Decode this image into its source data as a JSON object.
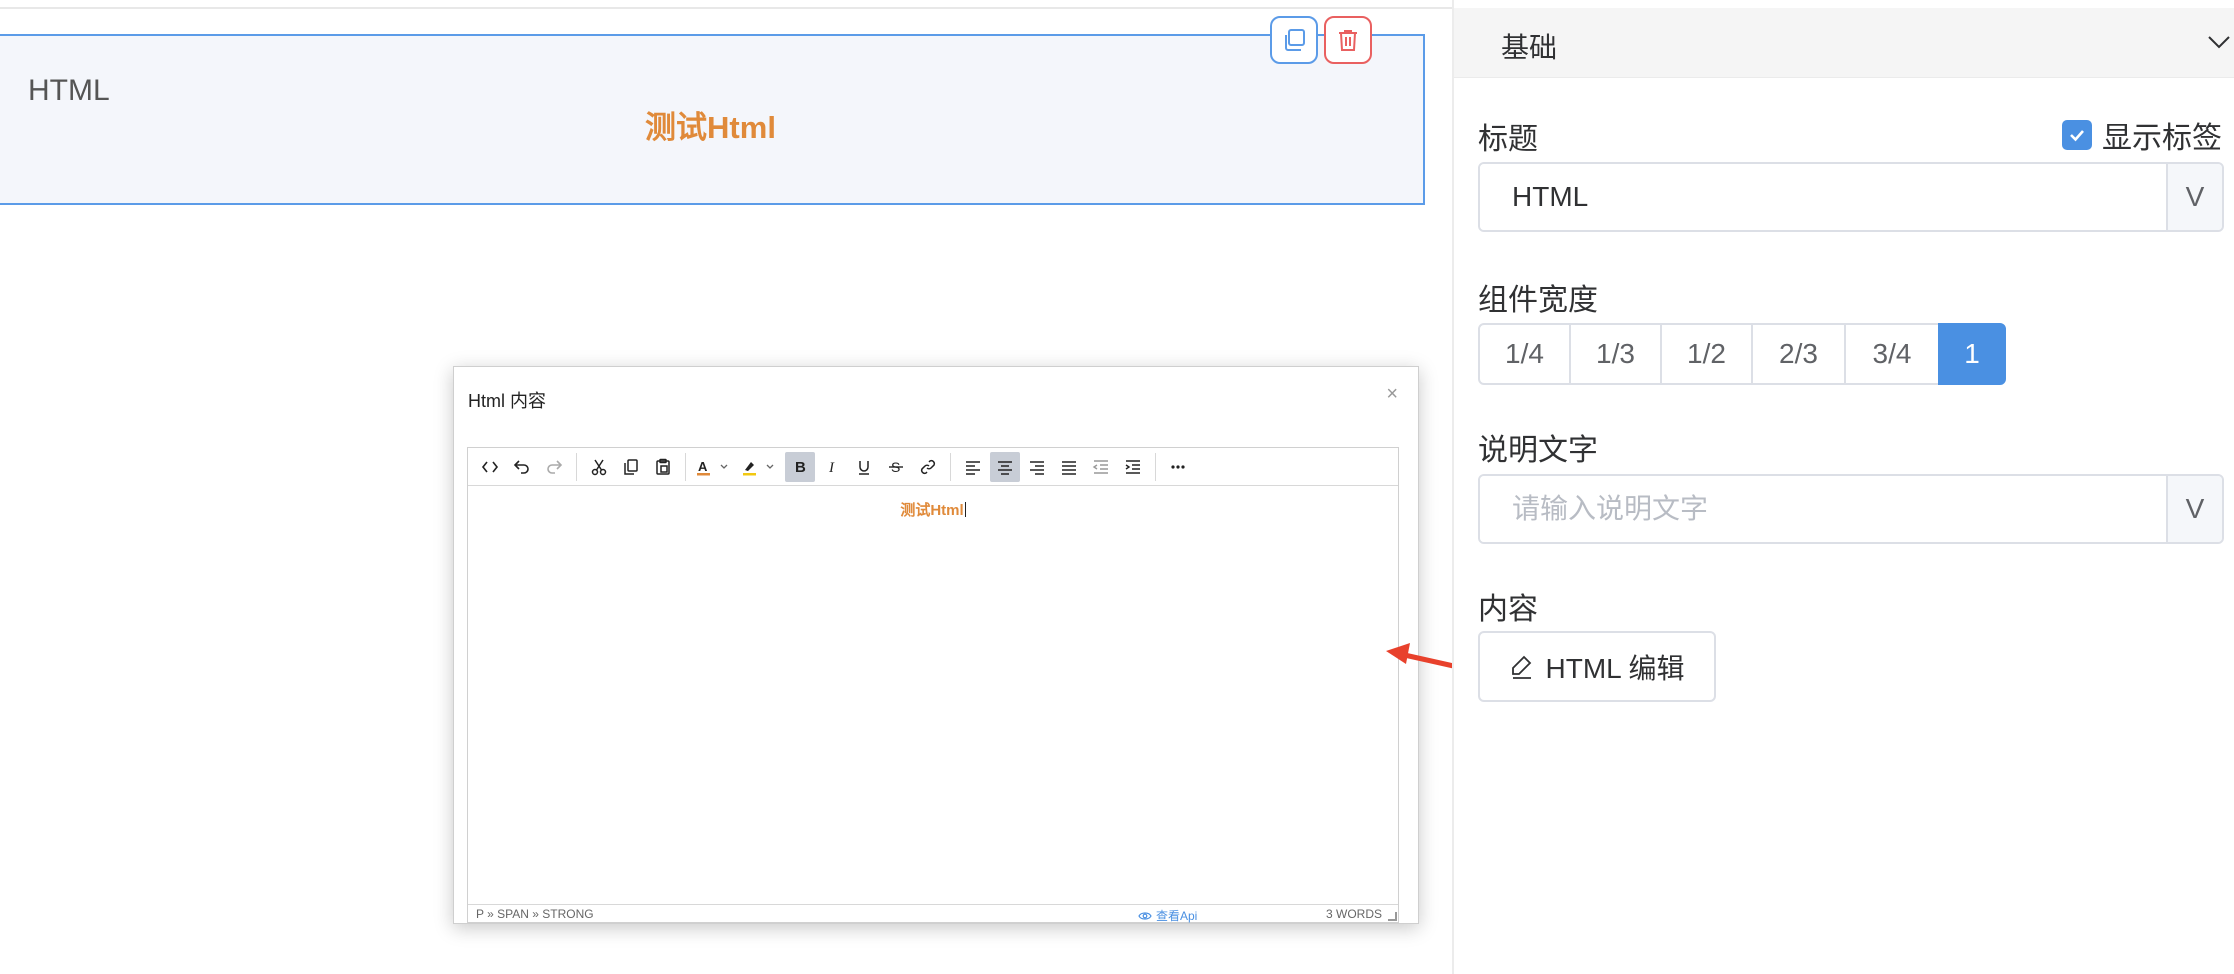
{
  "canvas": {
    "component": {
      "label": "HTML",
      "html_text": "测试Html"
    }
  },
  "dialog": {
    "title": "Html 内容",
    "close_glyph": "×",
    "toolbar": {
      "icons": [
        "source-code",
        "undo",
        "redo",
        "cut",
        "copy",
        "paste",
        "font-color",
        "highlight-color",
        "bold",
        "italic",
        "underline",
        "strikethrough",
        "link",
        "align-left",
        "align-center",
        "align-right",
        "align-justify",
        "outdent",
        "indent",
        "more"
      ]
    },
    "content_text": "测试Html",
    "status": {
      "path": "P » SPAN » STRONG",
      "api_link": "查看Api",
      "word_count": "3 WORDS"
    }
  },
  "panel": {
    "section_title": "基础",
    "title_field": {
      "label": "标题",
      "value": "HTML",
      "append": "V",
      "show_label_text": "显示标签",
      "show_label_checked": true
    },
    "width_field": {
      "label": "组件宽度",
      "options": [
        "1/4",
        "1/3",
        "1/2",
        "2/3",
        "3/4",
        "1"
      ],
      "selected": "1"
    },
    "description_field": {
      "label": "说明文字",
      "placeholder": "请输入说明文字",
      "append": "V"
    },
    "content_field": {
      "label": "内容",
      "button_label": "HTML 编辑"
    }
  },
  "colors": {
    "accent": "#4a90e2",
    "danger": "#e96060",
    "html_text": "#e08a3a",
    "arrow": "#e8412c"
  }
}
